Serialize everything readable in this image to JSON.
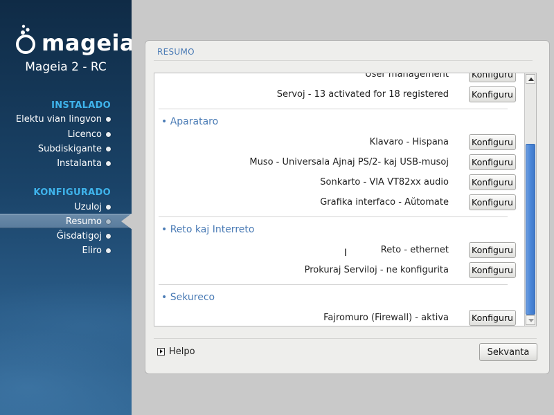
{
  "app": {
    "logo_text": "mageia",
    "version": "Mageia 2 - RC"
  },
  "sidebar": {
    "sections": [
      {
        "title": "INSTALADO",
        "items": [
          {
            "label": "Elektu vian lingvon"
          },
          {
            "label": "Licenco"
          },
          {
            "label": "Subdiskigante"
          },
          {
            "label": "Instalanta"
          }
        ]
      },
      {
        "title": "KONFIGURADO",
        "items": [
          {
            "label": "Uzuloj"
          },
          {
            "label": "Resumo",
            "active": true
          },
          {
            "label": "Ĝisdatigoj"
          },
          {
            "label": "Eliro"
          }
        ]
      }
    ]
  },
  "main": {
    "title": "RESUMO",
    "configure_label": "Konfiguru",
    "top_rows": [
      {
        "desc": "User management"
      },
      {
        "desc": "Servoj - 13 activated for 18 registered"
      }
    ],
    "categories": [
      {
        "title": "• Aparataro",
        "rows": [
          {
            "desc": "Klavaro - Hispana"
          },
          {
            "desc": "Muso - Universala Ajnaj PS/2- kaj USB-musoj"
          },
          {
            "desc": "Sonkarto - VIA VT82xx audio"
          },
          {
            "desc": "Grafika interfaco - Aŭtomate"
          }
        ]
      },
      {
        "title": "• Reto kaj Interreto",
        "rows": [
          {
            "desc": "Reto - ethernet"
          },
          {
            "desc": "Prokuraj Serviloj - ne konfigurita"
          }
        ]
      },
      {
        "title": "• Sekureco",
        "rows": [
          {
            "desc": "Fajromuro (Firewall) - aktiva"
          }
        ]
      }
    ]
  },
  "footer": {
    "help_label": "Helpo",
    "next_label": "Sekvanta"
  },
  "colors": {
    "accent": "#4a7bb5",
    "sidebar_heading": "#3fb4ec",
    "scroll_thumb": "#4a86d8"
  }
}
